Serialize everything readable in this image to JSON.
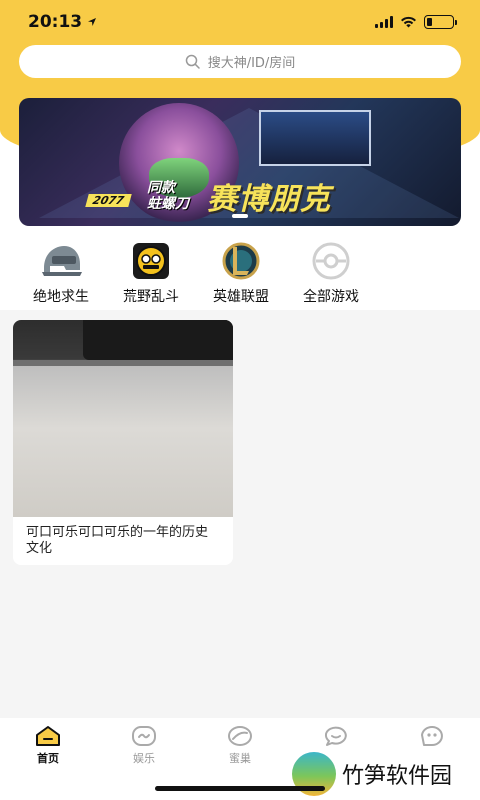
{
  "status": {
    "time": "20:13"
  },
  "search": {
    "placeholder": "搜大神/ID/房间"
  },
  "banner": {
    "title": "赛博朋克",
    "subtitle_line1": "同款",
    "subtitle_line2": "蛀螺刀",
    "year": "2077"
  },
  "games": [
    {
      "label": "绝地求生",
      "icon": "helmet-icon"
    },
    {
      "label": "荒野乱斗",
      "icon": "brawl-icon"
    },
    {
      "label": "英雄联盟",
      "icon": "lol-icon"
    },
    {
      "label": "全部游戏",
      "icon": "all-games-icon"
    }
  ],
  "card": {
    "caption": "可口可乐可口可乐的一年的历史文化"
  },
  "tabs": [
    {
      "label": "首页",
      "icon": "home-icon",
      "active": true
    },
    {
      "label": "娱乐",
      "icon": "entertainment-icon"
    },
    {
      "label": "蜜巢",
      "icon": "hive-icon"
    },
    {
      "label": "",
      "icon": "message-icon"
    },
    {
      "label": "",
      "icon": "profile-icon"
    }
  ],
  "watermark": {
    "text": "竹笋软件园"
  },
  "colors": {
    "accent": "#f8cb46",
    "banner_title": "#f7e35a"
  }
}
